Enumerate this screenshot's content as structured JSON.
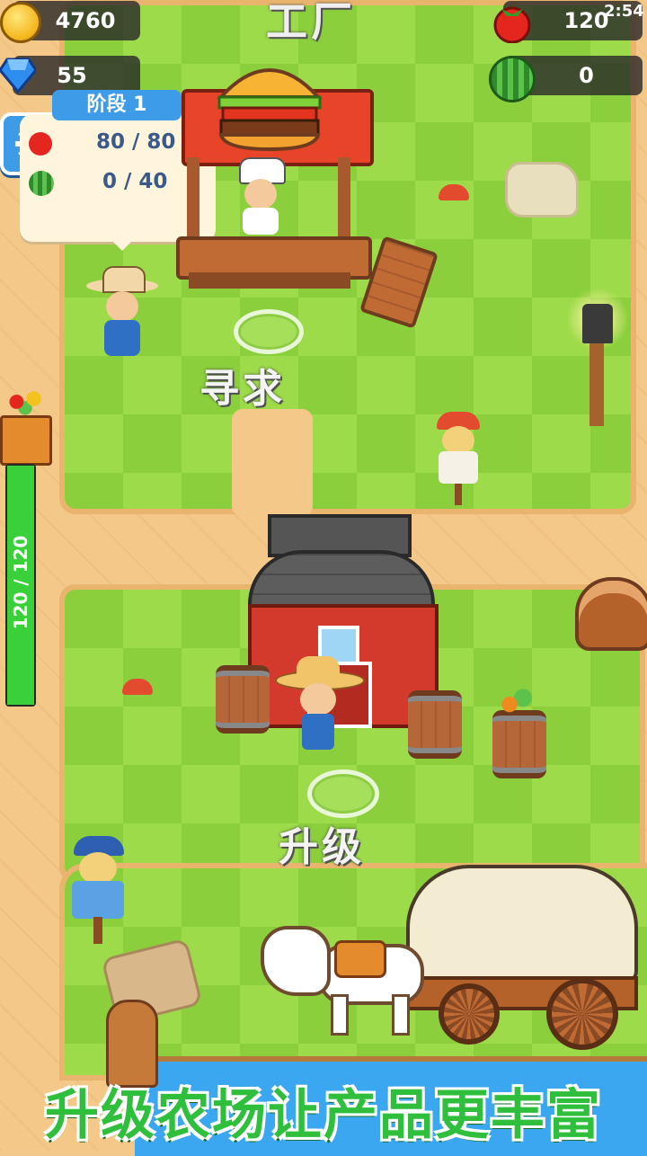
{
  "hud": {
    "coins": "4760",
    "gems": "55",
    "time": "2:54",
    "tomatoes": "120",
    "watermelons": "0",
    "title": "工厂"
  },
  "stage": {
    "title": "阶段 1",
    "row1": "80 / 80",
    "row2": "0 / 40"
  },
  "storage": {
    "value": "120 / 120",
    "fill_fraction": 1.0
  },
  "map_labels": {
    "seek": "寻求",
    "upgrade": "升级"
  },
  "banner": {
    "text": "升级农场让产品更丰富"
  },
  "colors": {
    "grass": "#9edb4a",
    "sand": "#f3c889",
    "banner_text": "#2fbf3c",
    "water": "#3aa7f0"
  }
}
